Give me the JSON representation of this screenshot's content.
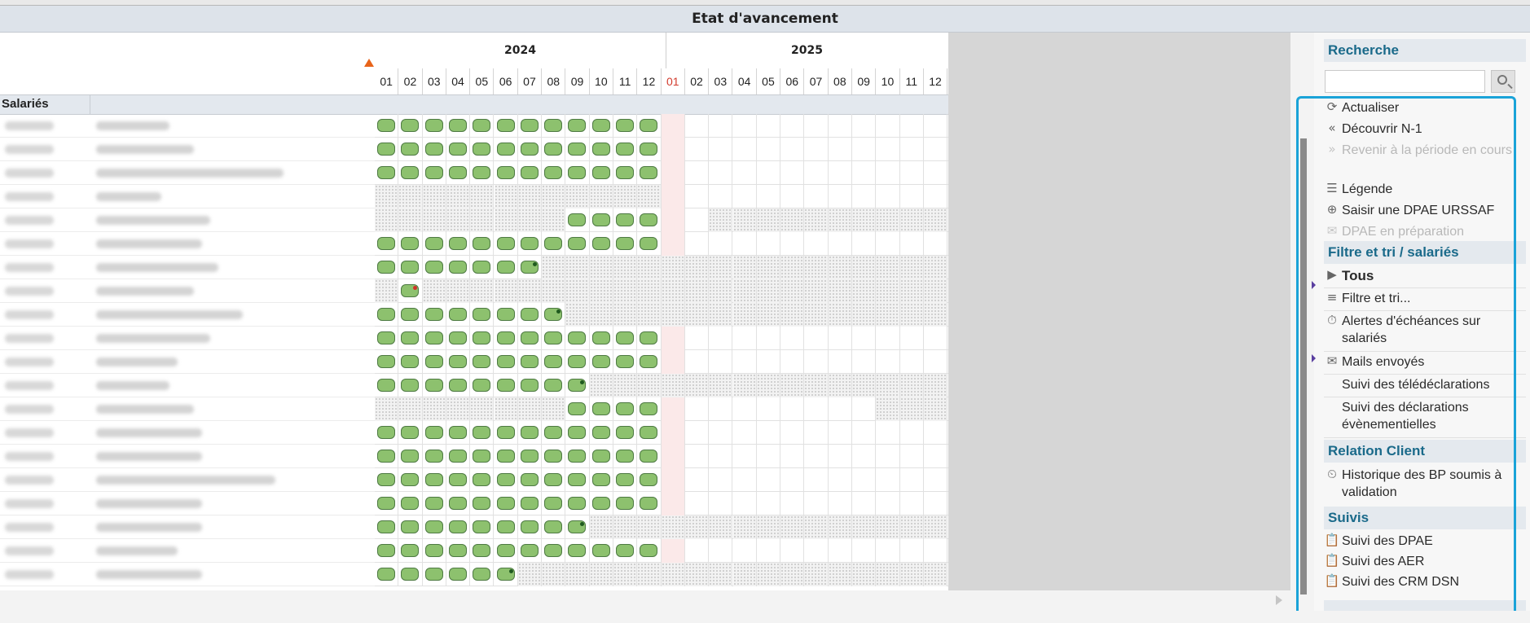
{
  "window": {
    "title": "Etat d'avancement"
  },
  "header": {
    "years": [
      "2024",
      "2025"
    ],
    "months": [
      "01",
      "02",
      "03",
      "04",
      "05",
      "06",
      "07",
      "08",
      "09",
      "10",
      "11",
      "12",
      "01",
      "02",
      "03",
      "04",
      "05",
      "06",
      "07",
      "08",
      "09",
      "10",
      "11",
      "12"
    ],
    "column_header": "Salariés"
  },
  "grid_rows": [
    {
      "filled": [
        1,
        2,
        3,
        4,
        5,
        6,
        7,
        8,
        9,
        10,
        11,
        12
      ],
      "hatched": [],
      "dot": null
    },
    {
      "filled": [
        1,
        2,
        3,
        4,
        5,
        6,
        7,
        8,
        9,
        10,
        11,
        12
      ],
      "hatched": [],
      "dot": null
    },
    {
      "filled": [
        1,
        2,
        3,
        4,
        5,
        6,
        7,
        8,
        9,
        10,
        11,
        12
      ],
      "hatched": [],
      "dot": null
    },
    {
      "filled": [],
      "hatched": [
        1,
        2,
        3,
        4,
        5,
        6,
        7,
        8,
        9,
        10,
        11,
        12
      ],
      "dot": null
    },
    {
      "filled": [
        9,
        10,
        11,
        12
      ],
      "hatched": [
        1,
        2,
        3,
        4,
        5,
        6,
        7,
        8,
        15,
        16,
        17,
        18,
        19,
        20,
        21,
        22,
        23,
        24
      ],
      "dot": null
    },
    {
      "filled": [
        1,
        2,
        3,
        4,
        5,
        6,
        7,
        8,
        9,
        10,
        11,
        12
      ],
      "hatched": [],
      "dot": null
    },
    {
      "filled": [
        1,
        2,
        3,
        4,
        5,
        6,
        7
      ],
      "hatched": [
        8,
        9,
        10,
        11,
        12,
        13,
        14,
        15,
        16,
        17,
        18,
        19,
        20,
        21,
        22,
        23,
        24
      ],
      "dot": {
        "month": 7,
        "color": "#1f5a1f"
      }
    },
    {
      "filled": [
        2
      ],
      "hatched": [
        1,
        3,
        4,
        5,
        6,
        7,
        8,
        9,
        10,
        11,
        12,
        13,
        14,
        15,
        16,
        17,
        18,
        19,
        20,
        21,
        22,
        23,
        24
      ],
      "dot": {
        "month": 2,
        "color": "#d2312a"
      }
    },
    {
      "filled": [
        1,
        2,
        3,
        4,
        5,
        6,
        7,
        8
      ],
      "hatched": [
        9,
        10,
        11,
        12,
        13,
        14,
        15,
        16,
        17,
        18,
        19,
        20,
        21,
        22,
        23,
        24
      ],
      "dot": {
        "month": 8,
        "color": "#1f5a1f"
      }
    },
    {
      "filled": [
        1,
        2,
        3,
        4,
        5,
        6,
        7,
        8,
        9,
        10,
        11,
        12
      ],
      "hatched": [],
      "dot": null
    },
    {
      "filled": [
        1,
        2,
        3,
        4,
        5,
        6,
        7,
        8,
        9,
        10,
        11,
        12
      ],
      "hatched": [],
      "dot": null
    },
    {
      "filled": [
        1,
        2,
        3,
        4,
        5,
        6,
        7,
        8,
        9
      ],
      "hatched": [
        10,
        11,
        12,
        13,
        14,
        15,
        16,
        17,
        18,
        19,
        20,
        21,
        22,
        23,
        24
      ],
      "dot": {
        "month": 9,
        "color": "#1f5a1f"
      }
    },
    {
      "filled": [
        9,
        10,
        11,
        12
      ],
      "hatched": [
        1,
        2,
        3,
        4,
        5,
        6,
        7,
        8,
        22,
        23,
        24
      ],
      "dot": null
    },
    {
      "filled": [
        1,
        2,
        3,
        4,
        5,
        6,
        7,
        8,
        9,
        10,
        11,
        12
      ],
      "hatched": [],
      "dot": null
    },
    {
      "filled": [
        1,
        2,
        3,
        4,
        5,
        6,
        7,
        8,
        9,
        10,
        11,
        12
      ],
      "hatched": [],
      "dot": null
    },
    {
      "filled": [
        1,
        2,
        3,
        4,
        5,
        6,
        7,
        8,
        9,
        10,
        11,
        12
      ],
      "hatched": [],
      "dot": null
    },
    {
      "filled": [
        1,
        2,
        3,
        4,
        5,
        6,
        7,
        8,
        9,
        10,
        11,
        12
      ],
      "hatched": [],
      "dot": null
    },
    {
      "filled": [
        1,
        2,
        3,
        4,
        5,
        6,
        7,
        8,
        9
      ],
      "hatched": [
        10,
        11,
        12,
        13,
        14,
        15,
        16,
        17,
        18,
        19,
        20,
        21,
        22,
        23,
        24
      ],
      "dot": {
        "month": 9,
        "color": "#1f5a1f"
      }
    },
    {
      "filled": [
        1,
        2,
        3,
        4,
        5,
        6,
        7,
        8,
        9,
        10,
        11,
        12
      ],
      "hatched": [],
      "dot": null
    },
    {
      "filled": [
        1,
        2,
        3,
        4,
        5,
        6
      ],
      "hatched": [
        7,
        8,
        9,
        10,
        11,
        12,
        13,
        14,
        15,
        16,
        17,
        18,
        19,
        20,
        21,
        22,
        23,
        24
      ],
      "dot": {
        "month": 6,
        "color": "#1f5a1f"
      }
    }
  ],
  "sidebar": {
    "search_title": "Recherche",
    "search_placeholder": "",
    "actions": [
      {
        "icon": "refresh-icon",
        "glyph": "⟳",
        "label": "Actualiser",
        "disabled": false
      },
      {
        "icon": "double-chevron-left-icon",
        "glyph": "«",
        "label": "Découvrir N-1",
        "disabled": false
      },
      {
        "icon": "double-chevron-right-icon",
        "glyph": "»",
        "label": "Revenir à la période en cours",
        "disabled": true
      },
      {
        "icon": "legend-icon",
        "glyph": "☰",
        "label": "Légende",
        "disabled": false
      },
      {
        "icon": "plus-circle-icon",
        "glyph": "⊕",
        "label": "Saisir une DPAE URSSAF",
        "disabled": false
      },
      {
        "icon": "envelope-icon",
        "glyph": "✉",
        "label": "DPAE en préparation",
        "disabled": true
      }
    ],
    "filter_title": "Filtre et tri / salariés",
    "filters": [
      {
        "icon": "play-circle-icon",
        "glyph": "▶",
        "label": "Tous",
        "bold": true
      },
      {
        "icon": "filter-icon",
        "glyph": "≡",
        "label": "Filtre et tri...",
        "bold": false
      },
      {
        "icon": "stopwatch-icon",
        "glyph": "⏱",
        "label": "Alertes d'échéances sur salariés",
        "bold": false
      },
      {
        "icon": "envelope-icon",
        "glyph": "✉",
        "label": "Mails envoyés",
        "bold": false
      },
      {
        "icon": "",
        "glyph": "",
        "label": "Suivi des télédéclarations",
        "bold": false
      },
      {
        "icon": "",
        "glyph": "",
        "label": "Suivi des déclarations évènementielles",
        "bold": false
      }
    ],
    "relation_title": "Relation Client",
    "relation_items": [
      {
        "icon": "history-icon",
        "glyph": "⏲",
        "label": "Historique des BP soumis à validation"
      }
    ],
    "suivis_title": "Suivis",
    "suivis_items": [
      {
        "icon": "clipboard-icon",
        "glyph": "📋",
        "label": "Suivi des DPAE"
      },
      {
        "icon": "clipboard-icon",
        "glyph": "📋",
        "label": "Suivi des AER"
      },
      {
        "icon": "clipboard-icon",
        "glyph": "📋",
        "label": "Suivi des CRM DSN"
      }
    ]
  },
  "colors": {
    "accent": "#1aa3d8",
    "pill": "#8dc16e",
    "pill_border": "#4e7a43",
    "section_text": "#1a6a8a"
  }
}
